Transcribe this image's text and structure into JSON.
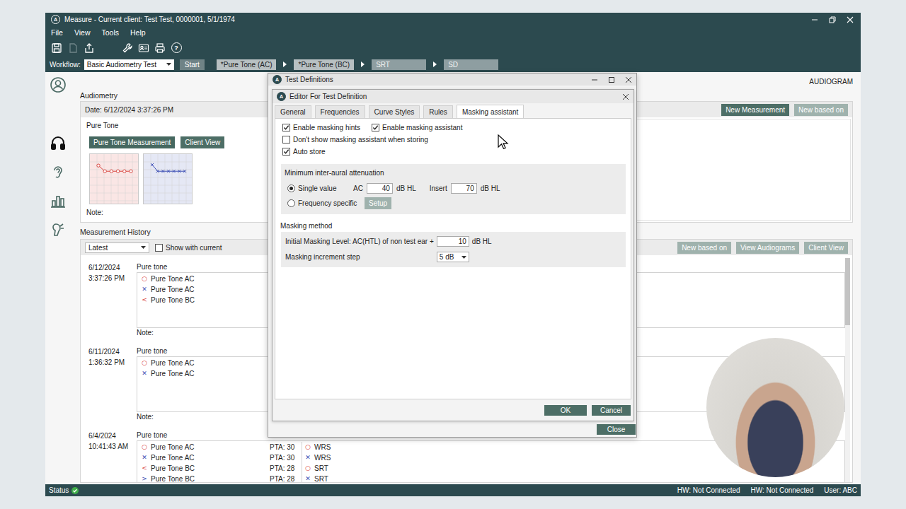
{
  "window": {
    "app_icon": "A",
    "title": "Measure - Current client: Test Test, 0000001, 5/1/1974"
  },
  "menu": [
    "File",
    "View",
    "Tools",
    "Help"
  ],
  "toolbar": [
    [
      {
        "kind": "save",
        "disabled": false
      },
      {
        "kind": "document",
        "disabled": true
      },
      {
        "kind": "export",
        "disabled": false
      }
    ],
    [
      {
        "kind": "wrench",
        "disabled": false
      },
      {
        "kind": "card",
        "disabled": false
      },
      {
        "kind": "print",
        "disabled": false
      },
      {
        "kind": "help",
        "disabled": false,
        "glyph": "?"
      }
    ]
  ],
  "workflow": {
    "label": "Workflow:",
    "value": "Basic Audiometry Test",
    "start": "Start",
    "steps": [
      {
        "label": "*Pure Tone (AC)",
        "active": true
      },
      {
        "label": "*Pure Tone (BC)",
        "active": true
      },
      {
        "label": "SRT",
        "active": false
      },
      {
        "label": "SD",
        "active": false
      }
    ]
  },
  "sidebar": [
    {
      "kind": "client",
      "selected": false
    },
    {
      "kind": "audiometry",
      "selected": true
    },
    {
      "kind": "hearing",
      "selected": false
    },
    {
      "kind": "statistics",
      "selected": false
    },
    {
      "kind": "fitting",
      "selected": false
    }
  ],
  "page_label": "AUDIOGRAM",
  "audiometry": {
    "title": "Audiometry",
    "date": "Date: 6/12/2024 3:37:26 PM",
    "buttons": [
      {
        "label": "New Measurement",
        "disabled": false
      },
      {
        "label": "New based on",
        "disabled": true
      }
    ],
    "section": "Pure Tone",
    "views": [
      {
        "label": "Pure Tone Measurement",
        "selected": true
      },
      {
        "label": "Client View",
        "selected": false
      }
    ],
    "thumbnails": [
      {
        "kind": "right",
        "color": "#d9453f",
        "values": [
          20,
          35,
          35,
          35,
          35,
          35
        ]
      },
      {
        "kind": "left",
        "color": "#3d4fb5",
        "values": [
          18,
          35,
          35,
          35,
          35,
          35,
          35
        ]
      }
    ],
    "note": "Note:"
  },
  "history": {
    "title": "Measurement History",
    "filter": "Latest",
    "show_with_current": {
      "label": "Show with current",
      "checked": false
    },
    "buttons": [
      {
        "label": "New based on",
        "disabled": true
      },
      {
        "label": "View Audiograms",
        "disabled": true
      },
      {
        "label": "Client View",
        "disabled": true
      }
    ],
    "scrollbar": {
      "level": 0.3
    },
    "entries": [
      {
        "date": "6/12/2024",
        "time": "3:37:26 PM",
        "type": "Pure tone",
        "items": [
          {
            "symbol": "○",
            "color": "#d9453f",
            "label": "Pure Tone AC"
          },
          {
            "symbol": "✕",
            "color": "#3d4fb5",
            "label": "Pure Tone AC"
          },
          {
            "symbol": "<",
            "color": "#d9453f",
            "label": "Pure Tone BC"
          }
        ],
        "extra": [],
        "note": "Note:"
      },
      {
        "date": "6/11/2024",
        "time": "1:36:32 PM",
        "type": "Pure tone",
        "items": [
          {
            "symbol": "○",
            "color": "#d9453f",
            "label": "Pure Tone AC"
          },
          {
            "symbol": "✕",
            "color": "#3d4fb5",
            "label": "Pure Tone AC"
          }
        ],
        "extra": [],
        "note": "Note:"
      },
      {
        "date": "6/4/2024",
        "time": "10:41:43 AM",
        "type": "Pure tone",
        "items": [
          {
            "symbol": "○",
            "color": "#d9453f",
            "label": "Pure Tone AC",
            "pta": "PTA: 30"
          },
          {
            "symbol": "✕",
            "color": "#3d4fb5",
            "label": "Pure Tone AC",
            "pta": "PTA: 30"
          },
          {
            "symbol": "<",
            "color": "#d9453f",
            "label": "Pure Tone BC",
            "pta": "PTA: 28"
          },
          {
            "symbol": ">",
            "color": "#3d4fb5",
            "label": "Pure Tone BC",
            "pta": "PTA: 28"
          }
        ],
        "extra": [
          {
            "symbol": "○",
            "color": "#d9453f",
            "label": "WRS"
          },
          {
            "symbol": "✕",
            "color": "#3d4fb5",
            "label": "WRS"
          },
          {
            "symbol": "○",
            "color": "#d9453f",
            "label": "SRT"
          },
          {
            "symbol": "✕",
            "color": "#3d4fb5",
            "label": "SRT"
          }
        ]
      }
    ]
  },
  "dialog": {
    "title": "Test Definitions",
    "close": "Close",
    "editor": {
      "title": "Editor For Test Definition",
      "tabs": [
        {
          "label": "General",
          "selected": false
        },
        {
          "label": "Frequencies",
          "selected": false
        },
        {
          "label": "Curve Styles",
          "selected": false
        },
        {
          "label": "Rules",
          "selected": false
        },
        {
          "label": "Masking assistant",
          "selected": true
        }
      ],
      "options": [
        [
          {
            "label": "Enable masking hints",
            "checked": true
          },
          {
            "label": "Enable masking assistant",
            "checked": true
          }
        ],
        [
          {
            "label": "Don't show masking assistant when storing",
            "checked": false
          }
        ],
        [
          {
            "label": "Auto store",
            "checked": true
          }
        ]
      ],
      "attenuation": {
        "title": "Minimum inter-aural attenuation",
        "modes": [
          {
            "label": "Single value",
            "selected": true
          },
          {
            "label": "Frequency specific",
            "selected": false
          }
        ],
        "fields": [
          {
            "label": "AC",
            "value": "40",
            "unit": "dB HL"
          },
          {
            "label": "Insert",
            "value": "70",
            "unit": "dB HL"
          }
        ],
        "setup": {
          "label": "Setup",
          "disabled": true
        }
      },
      "method": {
        "title": "Masking method",
        "initial": {
          "label": "Initial Masking Level: AC(HTL) of non test ear +",
          "value": "10",
          "unit": "dB HL"
        },
        "step": {
          "label": "Masking increment step",
          "value": "5 dB"
        }
      },
      "buttons": [
        "OK",
        "Cancel"
      ]
    }
  },
  "status_bar": {
    "label": "Status",
    "ok": true,
    "items": [
      "HW: Not Connected",
      "HW: Not Connected",
      "User: ABC"
    ]
  }
}
